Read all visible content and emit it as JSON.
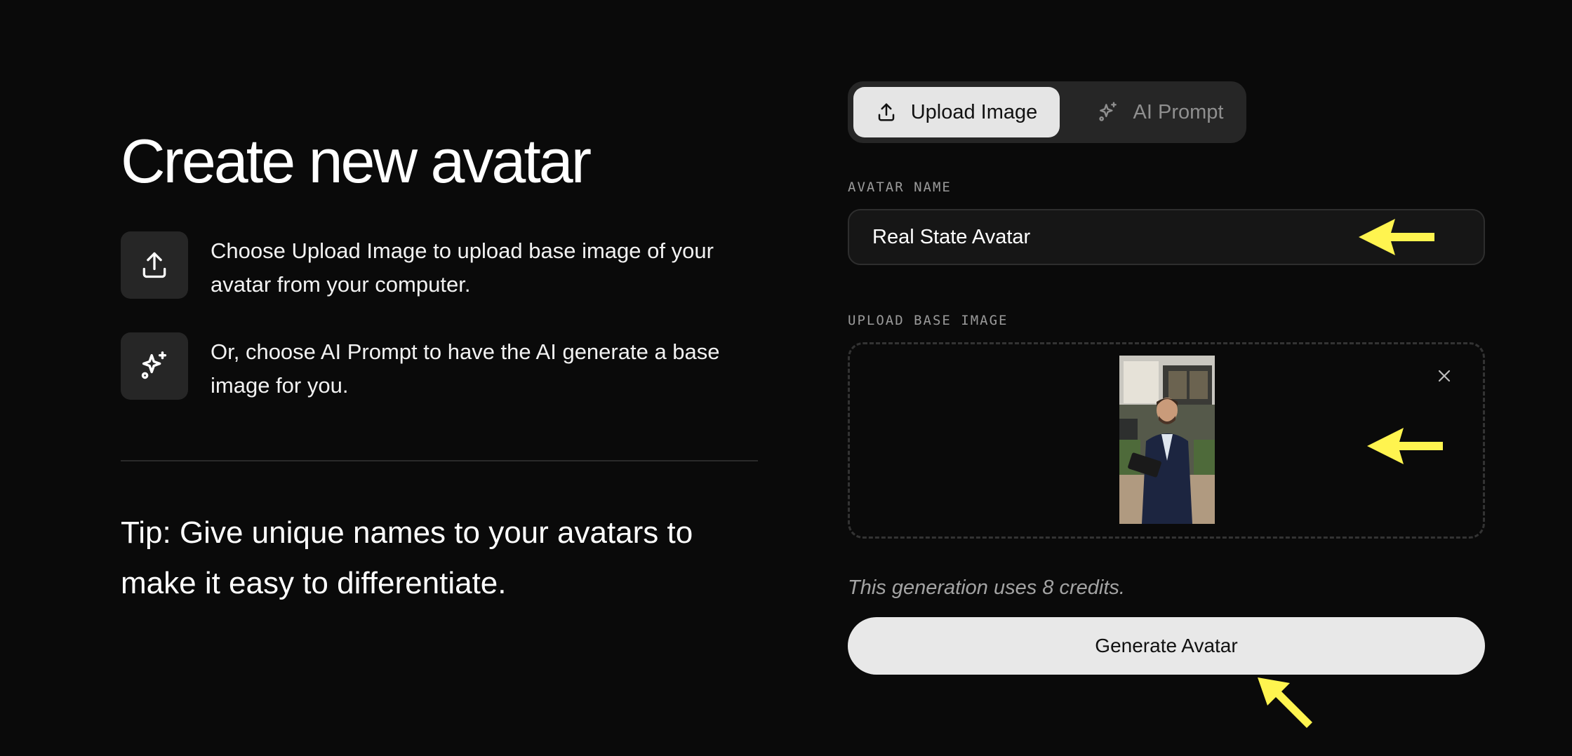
{
  "heading": {
    "title": "Create new avatar"
  },
  "info": [
    {
      "icon": "upload-icon",
      "text": "Choose Upload Image to upload base image of your avatar from your computer."
    },
    {
      "icon": "sparkles-icon",
      "text": "Or, choose AI Prompt to have the AI generate a base image for you."
    }
  ],
  "tip": "Tip: Give unique names to your avatars to make it easy to differentiate.",
  "tabs": [
    {
      "label": "Upload Image",
      "icon": "upload-icon",
      "active": true
    },
    {
      "label": "AI Prompt",
      "icon": "sparkles-icon",
      "active": false
    }
  ],
  "form": {
    "name_label": "AVATAR NAME",
    "name_value": "Real State Avatar",
    "upload_label": "UPLOAD BASE IMAGE",
    "credits_note": "This generation uses 8 credits.",
    "generate_label": "Generate Avatar"
  },
  "colors": {
    "background": "#0a0a0a",
    "annotation_arrow": "#fff44f",
    "button_bg": "#e8e8e8"
  }
}
